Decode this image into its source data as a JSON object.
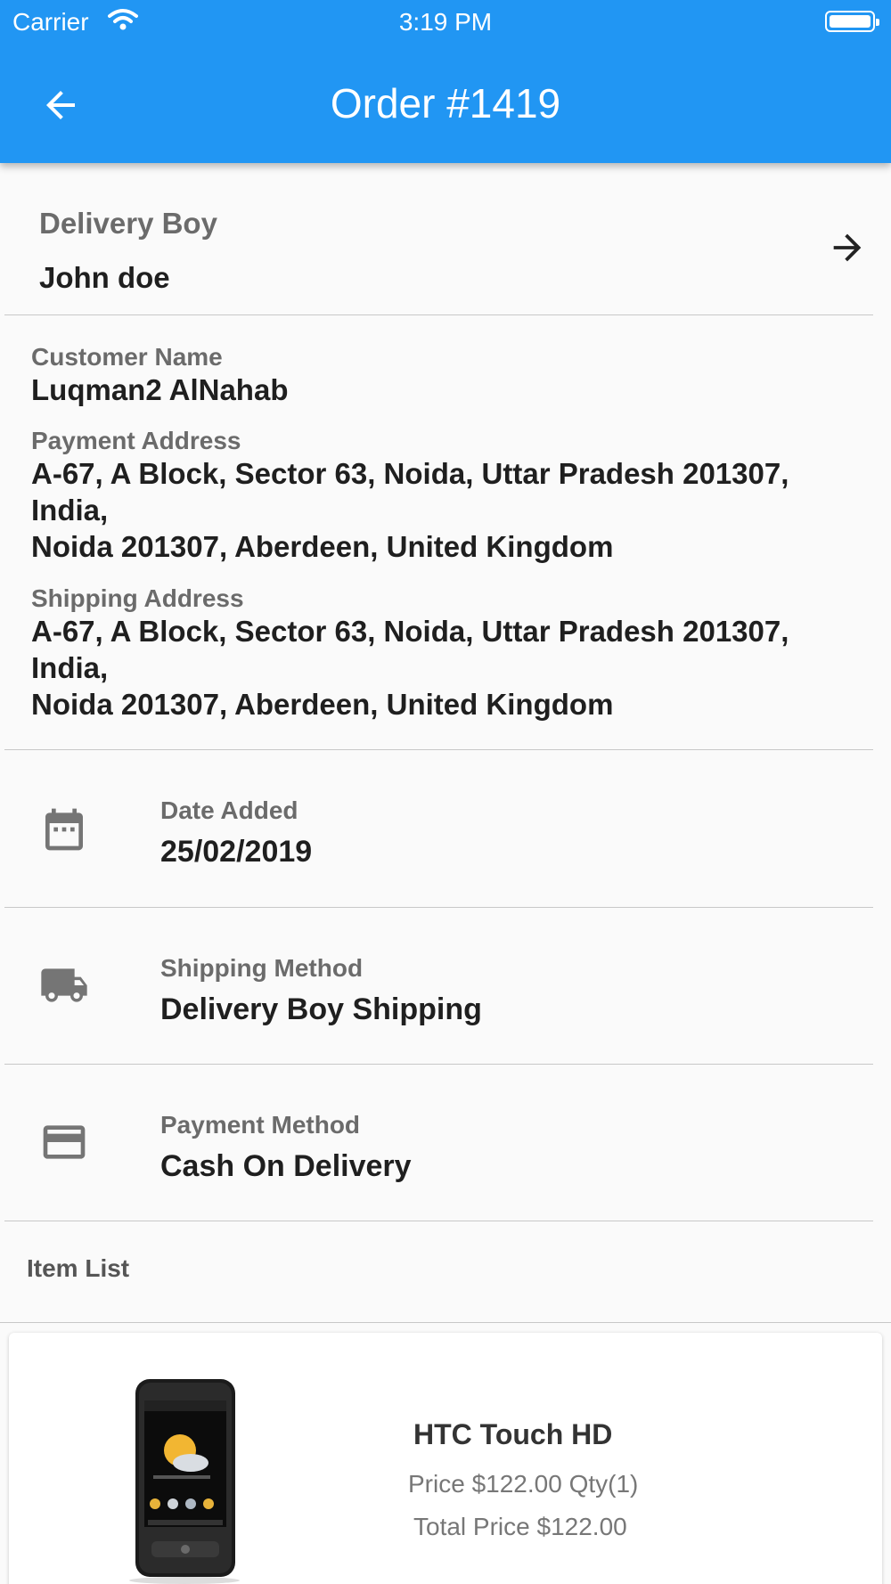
{
  "status_bar": {
    "carrier": "Carrier",
    "time": "3:19 PM"
  },
  "app_bar": {
    "title": "Order #1419",
    "back_icon": "arrow-back-icon"
  },
  "delivery_boy": {
    "label": "Delivery Boy",
    "name": "John doe",
    "arrow_icon": "arrow-forward-icon"
  },
  "customer": {
    "name_label": "Customer Name",
    "name": "Luqman2 AlNahab",
    "payment_address_label": "Payment Address",
    "payment_address": "A-67, A Block, Sector 63, Noida, Uttar Pradesh 201307, India,\nNoida 201307, Aberdeen, United Kingdom",
    "shipping_address_label": "Shipping Address",
    "shipping_address": "A-67, A Block, Sector 63, Noida, Uttar Pradesh 201307, India,\nNoida 201307, Aberdeen, United Kingdom"
  },
  "details": [
    {
      "icon": "calendar-icon",
      "label": "Date Added",
      "value": "25/02/2019"
    },
    {
      "icon": "truck-icon",
      "label": "Shipping Method",
      "value": "Delivery Boy Shipping"
    },
    {
      "icon": "credit-card-icon",
      "label": "Payment Method",
      "value": "Cash On Delivery"
    }
  ],
  "item_list": {
    "heading": "Item List",
    "items": [
      {
        "name": "HTC Touch HD",
        "price_line": "Price $122.00 Qty(1)",
        "total_line": "Total Price $122.00"
      }
    ]
  },
  "colors": {
    "app_bar": "#2196f3",
    "background": "#fafafa",
    "label_gray": "#6b6b6b"
  }
}
